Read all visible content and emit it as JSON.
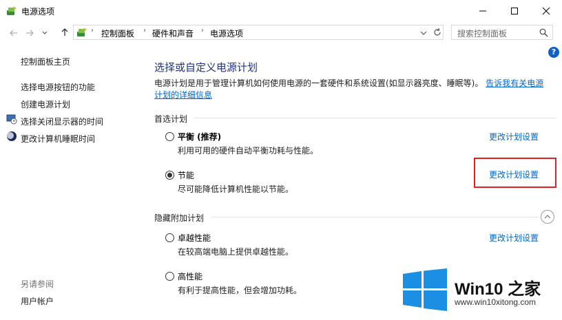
{
  "window": {
    "title": "电源选项",
    "icon": "power-options-icon"
  },
  "controls": [
    "minimize-icon",
    "maximize-icon",
    "close-icon"
  ],
  "address": {
    "breadcrumbs": [
      "控制面板",
      "硬件和声音",
      "电源选项"
    ],
    "search_placeholder": "搜索控制面板"
  },
  "sidebar": {
    "home": "控制面板主页",
    "links": [
      {
        "label": "选择电源按钮的功能",
        "icon": ""
      },
      {
        "label": "创建电源计划",
        "icon": ""
      },
      {
        "label": "选择关闭显示器的时间",
        "icon": "display-clock-icon"
      },
      {
        "label": "更改计算机睡眠时间",
        "icon": "moon-sleep-icon"
      }
    ],
    "see_also_label": "另请参阅",
    "see_also_links": [
      "用户帐户"
    ]
  },
  "main": {
    "title": "选择或自定义电源计划",
    "description": "电源计划是用于管理计算机如何使用电源的一套硬件和系统设置(如显示器亮度、睡眠等)。",
    "description_link": "告诉我有关电源计划的详细信息"
  },
  "preferred": {
    "label": "首选计划",
    "plans": [
      {
        "name": "平衡 (推荐)",
        "desc": "利用可用的硬件自动平衡功耗与性能。",
        "selected": false,
        "link": "更改计划设置"
      },
      {
        "name": "节能",
        "desc": "尽可能降低计算机性能以节能。",
        "selected": true,
        "link": "更改计划设置"
      }
    ]
  },
  "hidden": {
    "label": "隐藏附加计划",
    "plans": [
      {
        "name": "卓越性能",
        "desc": "在较高端电脑上提供卓越性能。",
        "selected": false,
        "link": "更改计划设置"
      },
      {
        "name": "高性能",
        "desc": "有利于提高性能，但会增加功耗。",
        "selected": false
      }
    ]
  },
  "watermark": {
    "brand": "Win10 之家",
    "url": "www.win10xitong.com",
    "colors": {
      "logo_blue": "#1a8fe3"
    }
  },
  "colors": {
    "title_blue": "#1e3287",
    "link_blue": "#0066cc",
    "highlight_red": "#e81c24"
  }
}
